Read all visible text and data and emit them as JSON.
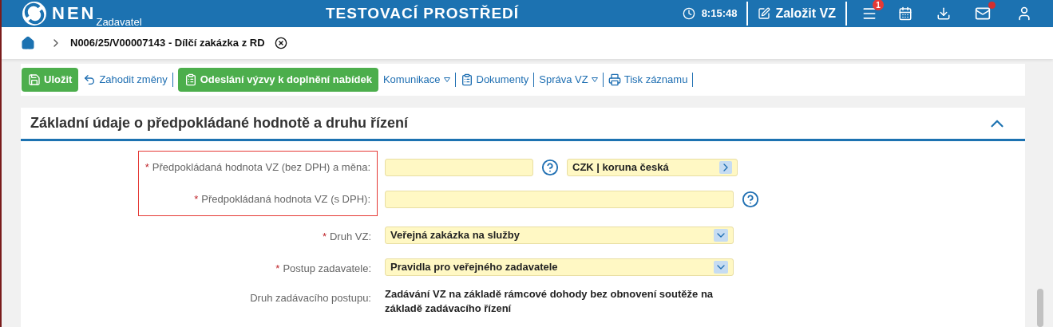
{
  "header": {
    "logo": "NEN",
    "subtitle": "Zadavatel",
    "title": "TESTOVACÍ PROSTŘEDÍ",
    "time": "8:15:48",
    "create_label": "Založit VZ",
    "menu_badge": "1",
    "mail_unread": true
  },
  "breadcrumb": {
    "current": "N006/25/V00007143 - Dílčí zakázka z RD"
  },
  "toolbar": [
    {
      "kind": "primary",
      "label": "Uložit",
      "dropdown": false
    },
    {
      "kind": "link",
      "label": "Zahodit změny",
      "dropdown": false
    },
    {
      "kind": "primary",
      "label": "Odeslání výzvy k doplnění nabídek",
      "dropdown": false
    },
    {
      "kind": "link",
      "label": "Komunikace",
      "dropdown": true
    },
    {
      "kind": "link",
      "label": "Dokumenty",
      "dropdown": false
    },
    {
      "kind": "link",
      "label": "Správa VZ",
      "dropdown": true
    },
    {
      "kind": "link",
      "label": "Tisk záznamu",
      "dropdown": false
    }
  ],
  "required_mark": "*",
  "section": {
    "title": "Základní údaje o předpokládané hodnotě a druhu řízení",
    "expanded": true,
    "groups": [
      {
        "highlighted": true,
        "fields": [
          {
            "kind": "text_currency",
            "label": "Předpokládaná hodnota VZ (bez DPH) a měna:",
            "required": true,
            "help": true,
            "currency": "CZK | koruna česká"
          },
          {
            "kind": "text",
            "label": "Předpokládaná hodnota VZ (s DPH):",
            "required": true,
            "help": true
          }
        ]
      },
      {
        "highlighted": false,
        "fields": [
          {
            "kind": "select",
            "label": "Druh VZ:",
            "required": true,
            "help": false,
            "value": "Veřejná zakázka na služby"
          },
          {
            "kind": "select",
            "label": "Postup zadavatele:",
            "required": true,
            "help": false,
            "value": "Pravidla pro veřejného zadavatele"
          },
          {
            "kind": "static",
            "label": "Druh zadávacího postupu:",
            "required": false,
            "help": false,
            "value": "Zadávání VZ na základě rámcové dohody bez obnovení soutěže na základě zadávacího řízení"
          }
        ]
      }
    ]
  }
}
